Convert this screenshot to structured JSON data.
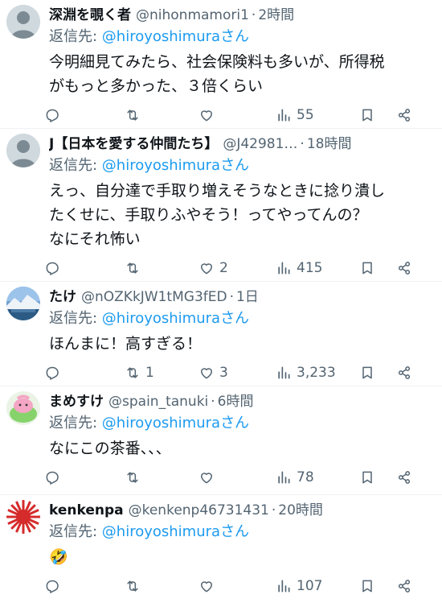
{
  "reply_prefix": "返信先: ",
  "tweets": [
    {
      "name": "深淵を覗く者",
      "handle": "@nihonmamori1",
      "time": "2時間",
      "reply_to": "@hiroyoshimura",
      "reply_suffix": "さん",
      "lines": [
        "今明細見てみたら、社会保険料も多いが、所得税",
        "がもっと多かった、３倍くらい"
      ],
      "replies": "",
      "retweets": "",
      "likes": "",
      "views": "55",
      "avatar": "default"
    },
    {
      "name": "J【日本を愛する仲間たち】",
      "handle": "@J42981…",
      "time": "18時間",
      "reply_to": "@hiroyoshimura",
      "reply_suffix": "さん",
      "lines": [
        "えっ、自分達で手取り増えそうなときに捻り潰し",
        "たくせに、手取りふやそう！ってやってんの？",
        "なにそれ怖い"
      ],
      "replies": "",
      "retweets": "",
      "likes": "2",
      "views": "415",
      "avatar": "default"
    },
    {
      "name": "たけ",
      "handle": "@nOZKkJW1tMG3fED",
      "time": "1日",
      "reply_to": "@hiroyoshimura",
      "reply_suffix": "さん",
      "lines": [
        "ほんまに！高すぎる！"
      ],
      "replies": "",
      "retweets": "1",
      "likes": "3",
      "views": "3,233",
      "avatar": "landscape"
    },
    {
      "name": "まめすけ",
      "handle": "@spain_tanuki",
      "time": "6時間",
      "reply_to": "@hiroyoshimura",
      "reply_suffix": "さん",
      "lines": [
        "なにこの茶番、、、"
      ],
      "replies": "",
      "retweets": "",
      "likes": "",
      "views": "78",
      "avatar": "cartoon"
    },
    {
      "name": "kenkenpa",
      "handle": "@kenkenp46731431",
      "time": "20時間",
      "reply_to": "@hiroyoshimura",
      "reply_suffix": "さん",
      "lines": [
        "🤣"
      ],
      "replies": "",
      "retweets": "",
      "likes": "",
      "views": "107",
      "avatar": "sunburst"
    }
  ],
  "icons": [
    "reply-icon",
    "retweet-icon",
    "like-icon",
    "views-icon",
    "bookmark-icon",
    "share-icon"
  ]
}
